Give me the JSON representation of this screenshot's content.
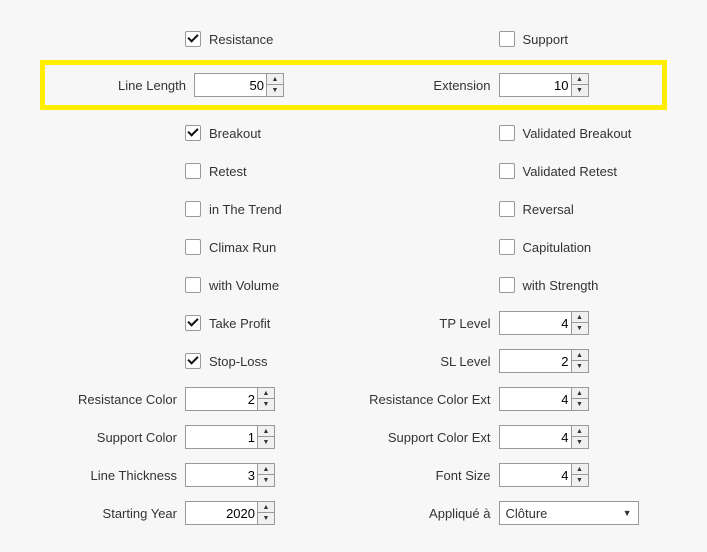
{
  "row1": {
    "left_label": "Resistance",
    "left_checked": true,
    "right_label": "Support",
    "right_checked": false
  },
  "highlight": {
    "left_label": "Line Length",
    "left_value": "50",
    "right_label": "Extension",
    "right_value": "10"
  },
  "row3": {
    "left_label": "Breakout",
    "left_checked": true,
    "right_label": "Validated Breakout",
    "right_checked": false
  },
  "row4": {
    "left_label": "Retest",
    "left_checked": false,
    "right_label": "Validated Retest",
    "right_checked": false
  },
  "row5": {
    "left_label": "in The Trend",
    "left_checked": false,
    "right_label": "Reversal",
    "right_checked": false
  },
  "row6": {
    "left_label": "Climax Run",
    "left_checked": false,
    "right_label": "Capitulation",
    "right_checked": false
  },
  "row7": {
    "left_label": "with Volume",
    "left_checked": false,
    "right_label": "with Strength",
    "right_checked": false
  },
  "row8": {
    "left_label": "Take Profit",
    "left_checked": true,
    "right_label": "TP Level",
    "right_value": "4"
  },
  "row9": {
    "left_label": "Stop-Loss",
    "left_checked": true,
    "right_label": "SL Level",
    "right_value": "2"
  },
  "row10": {
    "left_label": "Resistance Color",
    "left_value": "2",
    "right_label": "Resistance Color Ext",
    "right_value": "4"
  },
  "row11": {
    "left_label": "Support Color",
    "left_value": "1",
    "right_label": "Support Color Ext",
    "right_value": "4"
  },
  "row12": {
    "left_label": "Line Thickness",
    "left_value": "3",
    "right_label": "Font Size",
    "right_value": "4"
  },
  "row13": {
    "left_label": "Starting Year",
    "left_value": "2020",
    "right_label": "Appliqué à",
    "right_value": "Clôture"
  }
}
